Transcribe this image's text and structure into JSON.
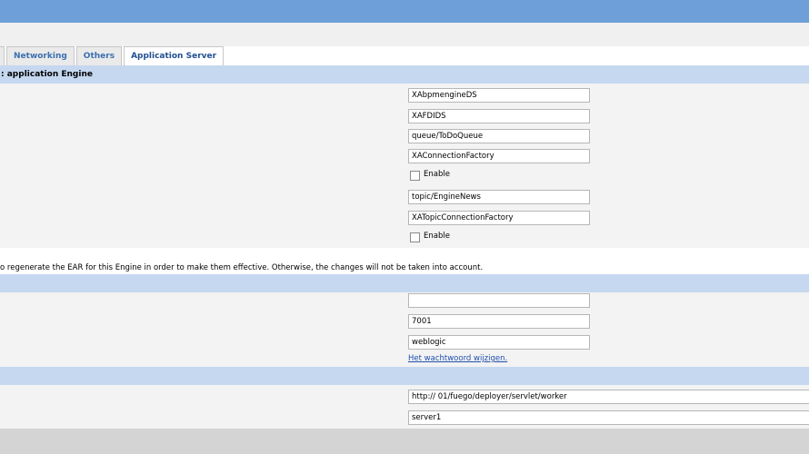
{
  "tabs": [
    {
      "label": ""
    },
    {
      "label": "Networking"
    },
    {
      "label": "Others"
    },
    {
      "label": "Application Server"
    }
  ],
  "section1": {
    "title": ": application Engine",
    "fields": [
      "XAbpmengineDS",
      "XAFDIDS",
      "queue/ToDoQueue",
      "XAConnectionFactory",
      "topic/EngineNews",
      "XATopicConnectionFactory"
    ],
    "checkbox1_label": "Enable",
    "checkbox2_label": "Enable"
  },
  "note": "o regenerate the EAR for this Engine in order to make them effective. Otherwise, the changes will not be taken into account.",
  "section2": {
    "title": "",
    "host": "",
    "port": "7001",
    "user": "weblogic",
    "change_password_link": "Het wachtwoord wijzigen."
  },
  "section3": {
    "title": "",
    "url": "http://                                                        01/fuego/deployer/servlet/worker",
    "server": "        server1"
  }
}
